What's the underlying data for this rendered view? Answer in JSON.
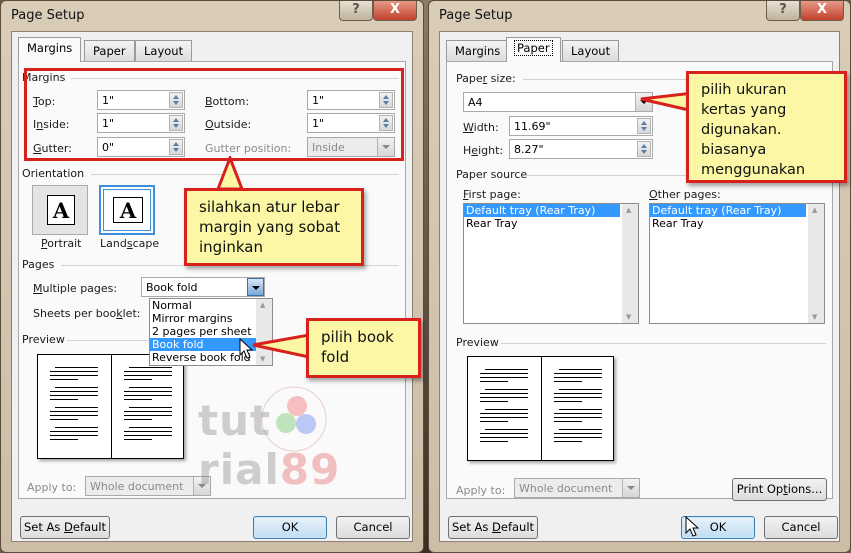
{
  "left_dialog": {
    "title": "Page Setup",
    "help_icon": "?",
    "close_icon": "X",
    "tabs": [
      {
        "label": "Margins",
        "active": true
      },
      {
        "label": "Paper",
        "active": false
      },
      {
        "label": "Layout",
        "active": false
      }
    ],
    "margins_group": "Margins",
    "fields": {
      "top": {
        "label_u": "T",
        "label_rest": "op:",
        "value": "1\""
      },
      "bottom": {
        "label_u": "B",
        "label_rest": "ottom:",
        "value": "1\""
      },
      "inside": {
        "label_pre": "I",
        "label_u": "n",
        "label_rest": "side:",
        "value": "1\""
      },
      "outside": {
        "label_u": "O",
        "label_rest": "utside:",
        "value": "1\""
      },
      "gutter": {
        "label_u": "G",
        "label_rest": "utter:",
        "value": "0\""
      },
      "gutter_position": {
        "label": "Gutter position:",
        "value": "Inside"
      }
    },
    "orientation_group": "Orientation",
    "orientation": {
      "portrait": {
        "label_u": "P",
        "label_rest": "ortrait",
        "glyph": "A"
      },
      "landscape": {
        "label_pre": "Land",
        "label_u": "s",
        "label_rest": "cape",
        "glyph": "A",
        "selected": true
      }
    },
    "pages_group": "Pages",
    "multiple_pages": {
      "label_u": "M",
      "label_rest": "ultiple pages:",
      "value": "Book fold"
    },
    "sheets_per_booklet": {
      "label_pre": "Sheets per boo",
      "label_u": "k",
      "label_rest": "let:"
    },
    "dropdown_options": [
      "Normal",
      "Mirror margins",
      "2 pages per sheet",
      "Book fold",
      "Reverse book fold"
    ],
    "dropdown_selected": "Book fold",
    "preview_group": "Preview",
    "apply_to": {
      "label": "Apply to:",
      "value": "Whole document"
    },
    "buttons": {
      "set_default_pre": "Set As ",
      "set_default_u": "D",
      "set_default_rest": "efault",
      "ok": "OK",
      "cancel": "Cancel"
    },
    "callout_margin": "silahkan atur lebar margin yang sobat inginkan",
    "callout_bookfold": "pilih book fold"
  },
  "right_dialog": {
    "title": "Page Setup",
    "help_icon": "?",
    "close_icon": "X",
    "tabs": [
      {
        "label": "Margins",
        "active": false
      },
      {
        "label": "Paper",
        "active": true
      },
      {
        "label": "Layout",
        "active": false
      }
    ],
    "paper_size_group": {
      "pre": "Pape",
      "u": "r",
      "rest": " size:"
    },
    "paper_size_value": "A4",
    "width": {
      "label_u": "W",
      "label_rest": "idth:",
      "value": "11.69\""
    },
    "height": {
      "label_pre": "H",
      "label_u": "e",
      "label_rest": "ight:",
      "value": "8.27\""
    },
    "paper_source_group": "Paper source",
    "first_page": {
      "label_u": "F",
      "label_rest": "irst page:",
      "items": [
        "Default tray (Rear Tray)",
        "Rear Tray"
      ],
      "selected": "Default tray (Rear Tray)"
    },
    "other_pages": {
      "label_u": "O",
      "label_rest": "ther pages:",
      "items": [
        "Default tray (Rear Tray)",
        "Rear Tray"
      ],
      "selected": "Default tray (Rear Tray)"
    },
    "preview_group": "Preview",
    "apply_to": {
      "label": "Apply to:",
      "value": "Whole document"
    },
    "print_options": {
      "pre": "Print Op",
      "u": "t",
      "rest": "ions..."
    },
    "buttons": {
      "set_default_pre": "Set As ",
      "set_default_u": "D",
      "set_default_rest": "efault",
      "ok": "OK",
      "cancel": "Cancel"
    },
    "callout_paper": "pilih ukuran kertas yang digunakan. biasanya menggunakan"
  },
  "watermark": {
    "text_a": "tut",
    "text_b": "rial",
    "text_c": "89"
  },
  "colors": {
    "callout_border": "#d8211c",
    "callout_fill": "#fbf7a5",
    "selection": "#3399ff",
    "focus_blue": "#3e8ede"
  }
}
